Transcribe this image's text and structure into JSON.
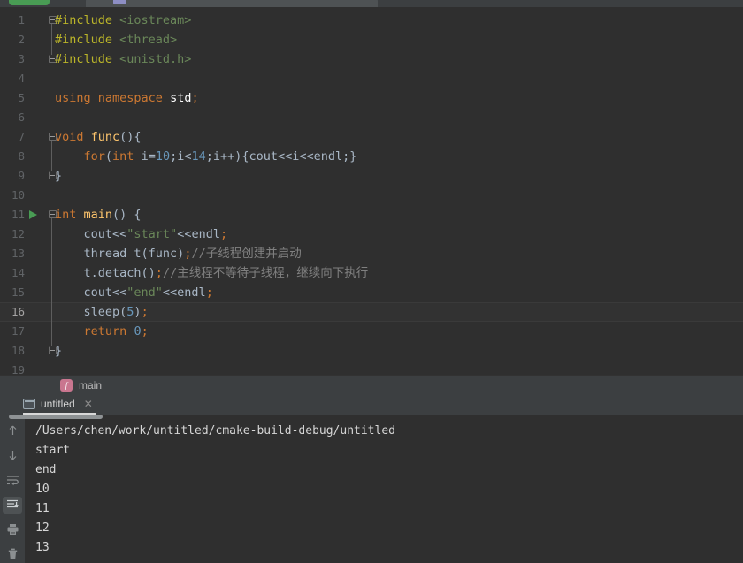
{
  "window": {
    "topbar": {
      "run_button_label": "",
      "tab_icon_name": "cmake-tab-icon"
    }
  },
  "editor": {
    "lines": [
      {
        "no": "1",
        "fold": "open",
        "tokens": [
          {
            "t": "#include ",
            "c": "t-pre"
          },
          {
            "t": "<iostream>",
            "c": "t-hdr"
          }
        ]
      },
      {
        "no": "2",
        "fold": "none",
        "tokens": [
          {
            "t": "#include ",
            "c": "t-pre"
          },
          {
            "t": "<thread>",
            "c": "t-hdr"
          }
        ]
      },
      {
        "no": "3",
        "fold": "close",
        "tokens": [
          {
            "t": "#include ",
            "c": "t-pre"
          },
          {
            "t": "<unistd.h>",
            "c": "t-hdr"
          }
        ]
      },
      {
        "no": "4",
        "fold": "none",
        "tokens": []
      },
      {
        "no": "5",
        "fold": "none",
        "tokens": [
          {
            "t": "using",
            "c": "t-kw"
          },
          {
            "t": " ",
            "c": "t-plain"
          },
          {
            "t": "namespace",
            "c": "t-kw"
          },
          {
            "t": " ",
            "c": "t-plain"
          },
          {
            "t": "std",
            "c": "t-std"
          },
          {
            "t": ";",
            "c": "t-semi"
          }
        ]
      },
      {
        "no": "6",
        "fold": "none",
        "tokens": []
      },
      {
        "no": "7",
        "fold": "open",
        "tokens": [
          {
            "t": "void",
            "c": "t-kw"
          },
          {
            "t": " ",
            "c": "t-plain"
          },
          {
            "t": "func",
            "c": "t-fn"
          },
          {
            "t": "(){",
            "c": "t-plain"
          }
        ]
      },
      {
        "no": "8",
        "fold": "none",
        "tokens": [
          {
            "t": "    ",
            "c": "t-plain"
          },
          {
            "t": "for",
            "c": "t-kw"
          },
          {
            "t": "(",
            "c": "t-plain"
          },
          {
            "t": "int",
            "c": "t-kw"
          },
          {
            "t": " i=",
            "c": "t-plain"
          },
          {
            "t": "10",
            "c": "t-num"
          },
          {
            "t": ";i<",
            "c": "t-plain"
          },
          {
            "t": "14",
            "c": "t-num"
          },
          {
            "t": ";i++){cout<<i<<endl;}",
            "c": "t-plain"
          }
        ]
      },
      {
        "no": "9",
        "fold": "close",
        "tokens": [
          {
            "t": "}",
            "c": "t-plain"
          }
        ]
      },
      {
        "no": "10",
        "fold": "none",
        "tokens": []
      },
      {
        "no": "11",
        "fold": "open",
        "run": true,
        "tokens": [
          {
            "t": "int",
            "c": "t-kw"
          },
          {
            "t": " ",
            "c": "t-plain"
          },
          {
            "t": "main",
            "c": "t-fn"
          },
          {
            "t": "() {",
            "c": "t-plain"
          }
        ]
      },
      {
        "no": "12",
        "fold": "none",
        "tokens": [
          {
            "t": "    cout<<",
            "c": "t-plain"
          },
          {
            "t": "\"start\"",
            "c": "t-str"
          },
          {
            "t": "<<endl",
            "c": "t-plain"
          },
          {
            "t": ";",
            "c": "t-semi"
          }
        ]
      },
      {
        "no": "13",
        "fold": "none",
        "tokens": [
          {
            "t": "    thread t(func)",
            "c": "t-plain"
          },
          {
            "t": ";",
            "c": "t-semi"
          },
          {
            "t": "//子线程创建并启动",
            "c": "t-cmt"
          }
        ]
      },
      {
        "no": "14",
        "fold": "none",
        "tokens": [
          {
            "t": "    t.detach()",
            "c": "t-plain"
          },
          {
            "t": ";",
            "c": "t-semi"
          },
          {
            "t": "//主线程不等待子线程，继续向下执行",
            "c": "t-cmt"
          }
        ]
      },
      {
        "no": "15",
        "fold": "none",
        "tokens": [
          {
            "t": "    cout<<",
            "c": "t-plain"
          },
          {
            "t": "\"end\"",
            "c": "t-str"
          },
          {
            "t": "<<endl",
            "c": "t-plain"
          },
          {
            "t": ";",
            "c": "t-semi"
          }
        ]
      },
      {
        "no": "16",
        "fold": "none",
        "current": true,
        "tokens": [
          {
            "t": "    sleep(",
            "c": "t-plain"
          },
          {
            "t": "5",
            "c": "t-num"
          },
          {
            "t": ")",
            "c": "t-plain"
          },
          {
            "t": ";",
            "c": "t-semi"
          }
        ]
      },
      {
        "no": "17",
        "fold": "none",
        "tokens": [
          {
            "t": "    ",
            "c": "t-plain"
          },
          {
            "t": "return",
            "c": "t-kw"
          },
          {
            "t": " ",
            "c": "t-plain"
          },
          {
            "t": "0",
            "c": "t-num"
          },
          {
            "t": ";",
            "c": "t-semi"
          }
        ]
      },
      {
        "no": "18",
        "fold": "close",
        "tokens": [
          {
            "t": "}",
            "c": "t-plain"
          }
        ]
      },
      {
        "no": "19",
        "fold": "none",
        "tokens": []
      }
    ]
  },
  "breadcrumb": {
    "icon_letter": "f",
    "label": "main"
  },
  "run_window": {
    "title": ":",
    "tab_label": "untitled",
    "tab_close": "✕",
    "toolbar": [
      {
        "name": "up-arrow-icon",
        "active": false
      },
      {
        "name": "down-arrow-icon",
        "active": false
      },
      {
        "name": "soft-wrap-icon",
        "active": false
      },
      {
        "name": "scroll-to-end-icon",
        "active": true
      },
      {
        "name": "print-icon",
        "active": false
      },
      {
        "name": "trash-icon",
        "active": false
      }
    ],
    "console_lines": [
      "/Users/chen/work/untitled/cmake-build-debug/untitled",
      "start",
      "end",
      "10",
      "11",
      "12",
      "13"
    ]
  },
  "colors": {
    "editor_bg": "#2f2f2f",
    "panel_bg": "#3c3f41",
    "accent_green": "#499c54",
    "keyword_orange": "#cc7832",
    "number_blue": "#6897bb",
    "string_green": "#6a8759",
    "preproc_yellow": "#bbb529",
    "comment_gray": "#808080",
    "function_yellow": "#ffc66d",
    "breadcrumb_pink": "#c9768f"
  }
}
